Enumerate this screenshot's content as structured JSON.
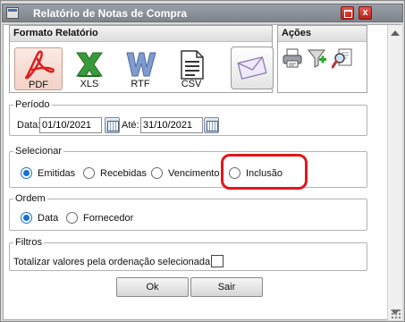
{
  "window": {
    "title": "Relatório de Notas de Compra",
    "close_glyph": "x"
  },
  "format_panel": {
    "heading": "Formato Relatório",
    "formats": [
      {
        "label": "PDF",
        "icon": "pdf-icon",
        "selected": true
      },
      {
        "label": "XLS",
        "icon": "excel-icon"
      },
      {
        "label": "RTF",
        "icon": "word-icon"
      },
      {
        "label": "CSV",
        "icon": "document-icon"
      }
    ],
    "email_icon": "envelope-icon"
  },
  "actions_panel": {
    "heading": "Ações",
    "icons": [
      "printer-icon",
      "filter-add-icon",
      "preview-search-icon"
    ]
  },
  "periodo": {
    "legend": "Período",
    "from_label": "Data:",
    "from_value": "01/10/2021",
    "to_label": "Até:",
    "to_value": "31/10/2021"
  },
  "selecionar": {
    "legend": "Selecionar",
    "options": [
      {
        "label": "Emitidas",
        "checked": true
      },
      {
        "label": "Recebidas",
        "checked": false
      },
      {
        "label": "Vencimento",
        "checked": false
      },
      {
        "label": "Inclusão",
        "checked": false
      }
    ]
  },
  "ordem": {
    "legend": "Ordem",
    "options": [
      {
        "label": "Data",
        "checked": true
      },
      {
        "label": "Fornecedor",
        "checked": false
      }
    ]
  },
  "filtros": {
    "legend": "Filtros",
    "totalize_label": "Totalizar valores pela ordenação selecionada",
    "totalize_checked": false
  },
  "buttons": {
    "ok": "Ok",
    "sair": "Sair"
  },
  "colors": {
    "accent": "#1a6fd0",
    "highlight": "#e3161b",
    "titlebar": "#8a9098"
  }
}
